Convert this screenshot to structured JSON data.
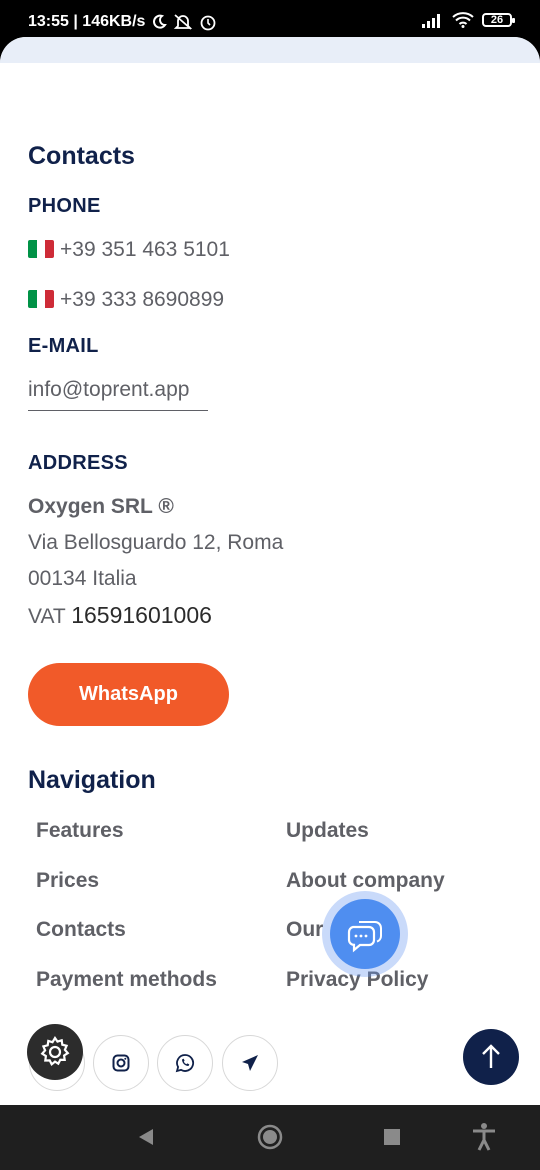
{
  "status_bar": {
    "time_speed": "13:55 | 146KB/s",
    "battery": "26"
  },
  "contacts": {
    "title": "Contacts",
    "phone_heading": "PHONE",
    "phones": [
      "+39 351 463 5101",
      "+39 333 8690899"
    ],
    "email_heading": "E-MAIL",
    "email": "info@toprent.app",
    "address_heading": "ADDRESS",
    "company": "Oxygen SRL ®",
    "street": "Via Bellosguardo 12, Roma",
    "city": "00134 Italia",
    "vat_label": "VAT",
    "vat_number": "16591601006",
    "whatsapp_button": "WhatsApp"
  },
  "navigation": {
    "title": "Navigation",
    "left": [
      "Features",
      "Prices",
      "Contacts",
      "Payment methods"
    ],
    "right": [
      "Updates",
      "About company",
      "Our",
      "Privacy Policy"
    ]
  },
  "icons": {
    "chat": "chat-bubbles-icon",
    "settings": "gear-icon",
    "social": [
      "instagram-icon",
      "whatsapp-icon",
      "telegram-icon"
    ],
    "scroll_top": "arrow-up-icon"
  },
  "colors": {
    "heading": "#10214a",
    "text": "#5f6066",
    "accent": "#f15a29",
    "chat": "#4f8ef0"
  }
}
